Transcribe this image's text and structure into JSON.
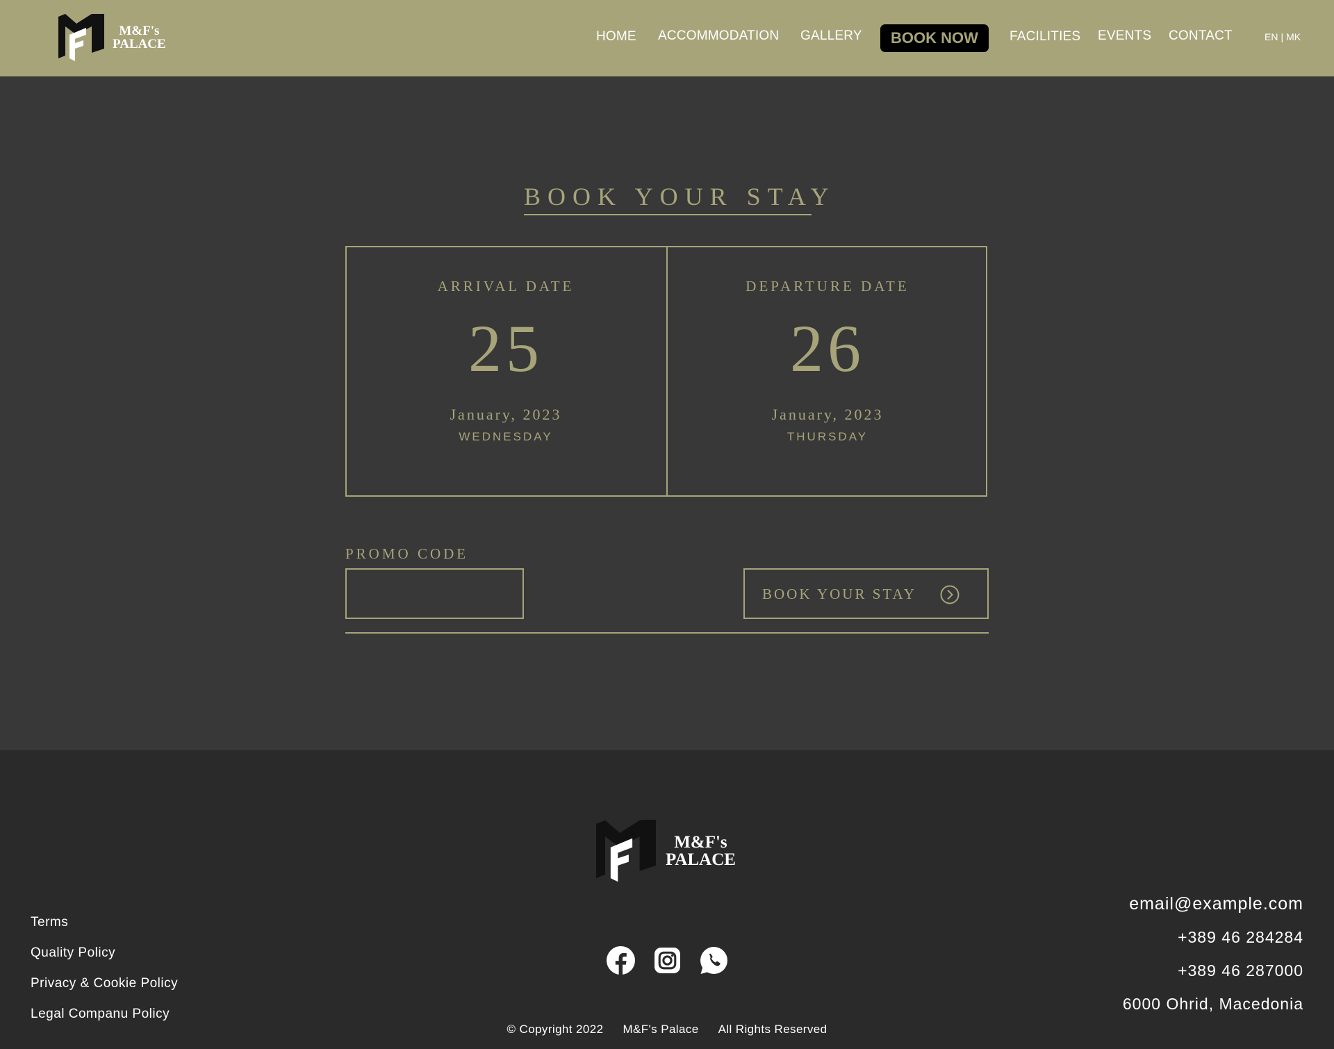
{
  "brand": {
    "line1": "M&F's",
    "line2": "PALACE"
  },
  "nav": {
    "home": "HOME",
    "accommodation": "ACCOMMODATION",
    "gallery": "GALLERY",
    "book_now": "BOOK NOW",
    "facilities": "FACILITIES",
    "events": "EVENTS",
    "contact": "CONTACT"
  },
  "lang": {
    "en": "EN",
    "separator": "|",
    "mk": "MK"
  },
  "booking": {
    "title": "BOOK YOUR STAY",
    "arrival": {
      "label": "ARRIVAL DATE",
      "day": "25",
      "month_year": "January, 2023",
      "weekday": "WEDNESDAY"
    },
    "departure": {
      "label": "DEPARTURE DATE",
      "day": "26",
      "month_year": "January, 2023",
      "weekday": "THURSDAY"
    },
    "promo_label": "PROMO CODE",
    "promo_value": "",
    "submit_label": "BOOK YOUR STAY"
  },
  "footer": {
    "links": [
      "Terms",
      "Quality Policy",
      "Privacy & Cookie Policy",
      "Legal Companu Policy"
    ],
    "socials": [
      "facebook-icon",
      "instagram-icon",
      "whatsapp-icon"
    ],
    "copyright": {
      "notice": "© Copyright 2022",
      "name": "M&F's Palace",
      "rights": "All Rights Reserved"
    },
    "contact": {
      "email": "email@example.com",
      "phone1": "+389 46 284284",
      "phone2": "+389 46 287000",
      "address": "6000 Ohrid, Macedonia"
    }
  },
  "colors": {
    "accent": "#a7a47a",
    "header_bg": "#a7a47a",
    "page_bg": "#383838",
    "footer_bg": "#2a2a2a"
  }
}
